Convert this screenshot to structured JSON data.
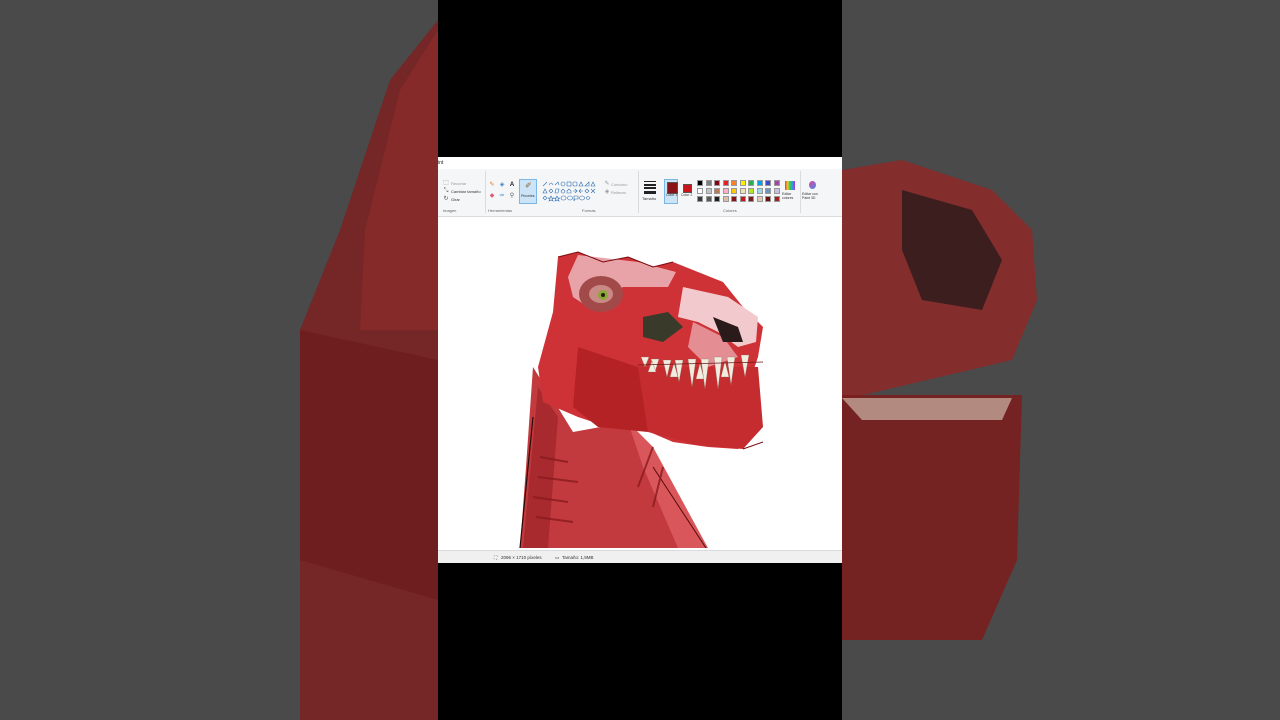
{
  "app": {
    "title_fragment": "int"
  },
  "ribbon": {
    "imagen": {
      "label": "Imagen",
      "select": "Recortar",
      "resize": "Cambiar tamaño",
      "rotate": "Girar"
    },
    "herramientas": {
      "label": "Herramientas"
    },
    "pinceles": {
      "label": "Pinceles"
    },
    "formas": {
      "label": "Formas",
      "outline": "Contorno",
      "fill": "Rellenar"
    },
    "tamano": {
      "label": "Tamaño"
    },
    "color1": {
      "label": "Color 1",
      "value": "#8a1318"
    },
    "color2": {
      "label": "Color 2",
      "value": "#c8161d"
    },
    "colores": {
      "label": "Colores"
    },
    "edit_colors": {
      "label": "Editar colores"
    },
    "paint3d": {
      "label": "Editar con Paint 3D"
    }
  },
  "palette": [
    [
      "#000000",
      "#7f7f7f",
      "#880015",
      "#ed1c24",
      "#ff7f27",
      "#fff200",
      "#22b14c",
      "#00a2e8",
      "#3f48cc",
      "#a349a4"
    ],
    [
      "#ffffff",
      "#c3c3c3",
      "#b97a57",
      "#ffaec9",
      "#ffc90e",
      "#efe4b0",
      "#b5e61d",
      "#99d9ea",
      "#7092be",
      "#c8bfe7"
    ],
    [
      "#3a3a3a",
      "#5a5a5a",
      "#1e1e1e",
      "#d8c0a8",
      "#8a1318",
      "#c8161d",
      "#7a1a1a",
      "#e0c8b8",
      "#6a1010",
      "#a02020"
    ]
  ],
  "status": {
    "dimensions": "2096 × 1710 píxeles",
    "size": "Tamaño: 1,9MB"
  }
}
